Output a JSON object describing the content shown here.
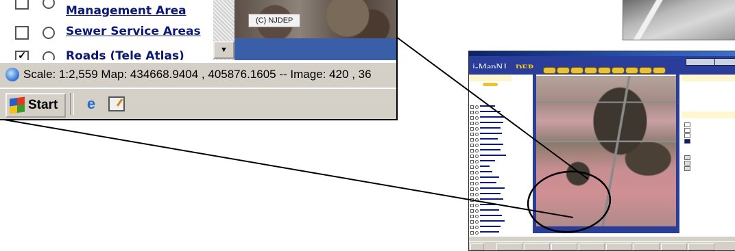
{
  "inset": {
    "layers": [
      {
        "label": "Management Area",
        "checked": false
      },
      {
        "label": "Sewer Service Areas",
        "checked": false
      },
      {
        "label": "Roads (Tele Atlas)",
        "checked": true
      }
    ],
    "map_copyright": "(C) NJDEP",
    "status_text": "Scale: 1:2,559 Map: 434668.9404 , 405876.1605 -- Image: 420 , 36",
    "taskbar": {
      "start_label": "Start",
      "icons": [
        "internet-explorer-icon",
        "desktop-icon"
      ]
    }
  },
  "app": {
    "brand": "i-MapNJ",
    "brand_suffix": "DEP"
  },
  "colors": {
    "link_blue": "#0d1a73",
    "map_frame_blue": "#3a5fa8",
    "brand_bar_blue": "#2a3d9a",
    "brand_yellow": "#ffd000",
    "panel_header": "#fff7cf",
    "windows_gray": "#d4d0c8"
  }
}
